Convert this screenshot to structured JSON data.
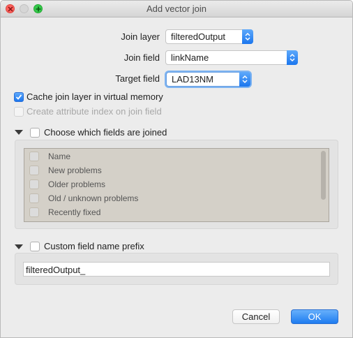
{
  "window": {
    "title": "Add vector join"
  },
  "form": {
    "join_layer_label": "Join layer",
    "join_layer_value": "filteredOutput",
    "join_field_label": "Join field",
    "join_field_value": "linkName",
    "target_field_label": "Target field",
    "target_field_value": "LAD13NM"
  },
  "options": {
    "cache_label": "Cache join layer in virtual memory",
    "cache_checked": true,
    "index_label": "Create attribute index on join field",
    "index_enabled": false
  },
  "fields_group": {
    "label": "Choose which fields are joined",
    "checked": false,
    "items": [
      {
        "label": "Name",
        "checked": false
      },
      {
        "label": "New problems",
        "checked": false
      },
      {
        "label": "Older problems",
        "checked": false
      },
      {
        "label": "Old / unknown problems",
        "checked": false
      },
      {
        "label": "Recently fixed",
        "checked": false
      }
    ]
  },
  "prefix_group": {
    "label": "Custom field name prefix",
    "checked": false,
    "value": "filteredOutput_"
  },
  "buttons": {
    "cancel_label": "Cancel",
    "ok_label": "OK"
  },
  "colors": {
    "accent": "#1b76ee",
    "close": "#fc605c",
    "zoom": "#34c84a"
  }
}
